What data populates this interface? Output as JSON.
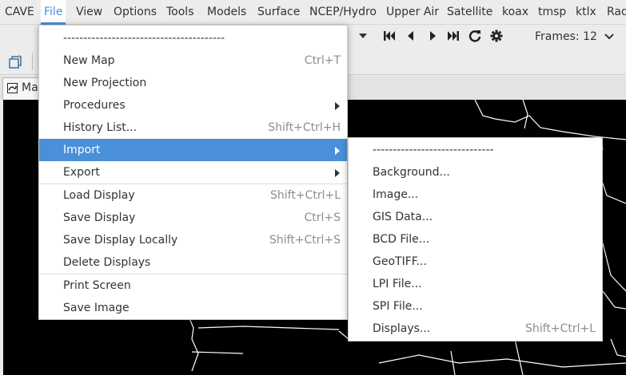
{
  "menubar": {
    "items": [
      "CAVE",
      "File",
      "View",
      "Options",
      "Tools",
      "Models",
      "Surface",
      "NCEP/Hydro",
      "Upper Air",
      "Satellite",
      "koax",
      "tmsp",
      "ktlx",
      "Rad"
    ]
  },
  "toolbar": {
    "frames_label": "Frames: 12",
    "icons": [
      "dropdown-arrow-icon",
      "first-frame-icon",
      "step-back-icon",
      "step-forward-icon",
      "last-frame-icon",
      "loop-icon",
      "settings-icon",
      "frames-dropdown-icon"
    ]
  },
  "tab": {
    "label": "Map"
  },
  "file_menu": {
    "separator_label": "----------------------------------------",
    "items": [
      {
        "label": "New Map",
        "accel": "Ctrl+T"
      },
      {
        "label": "New Projection",
        "accel": ""
      },
      {
        "label": "Procedures",
        "accel": "",
        "submenu": true
      },
      {
        "label": "History List...",
        "accel": "Shift+Ctrl+H"
      },
      {
        "label": "Import",
        "accel": "",
        "submenu": true,
        "highlighted": true
      },
      {
        "label": "Export",
        "accel": "",
        "submenu": true
      },
      {
        "label": "Load Display",
        "accel": "Shift+Ctrl+L"
      },
      {
        "label": "Save Display",
        "accel": "Ctrl+S"
      },
      {
        "label": "Save Display Locally",
        "accel": "Shift+Ctrl+S"
      },
      {
        "label": "Delete Displays",
        "accel": ""
      },
      {
        "label": "Print Screen",
        "accel": ""
      },
      {
        "label": "Save Image",
        "accel": ""
      }
    ]
  },
  "import_menu": {
    "separator_label": "------------------------------",
    "items": [
      {
        "label": "Background...",
        "accel": ""
      },
      {
        "label": "Image...",
        "accel": ""
      },
      {
        "label": "GIS Data...",
        "accel": ""
      },
      {
        "label": "BCD File...",
        "accel": ""
      },
      {
        "label": "GeoTIFF...",
        "accel": ""
      },
      {
        "label": "LPI File...",
        "accel": ""
      },
      {
        "label": "SPI File...",
        "accel": ""
      },
      {
        "label": "Displays...",
        "accel": "Shift+Ctrl+L"
      }
    ]
  },
  "colors": {
    "highlight": "#4a90d9",
    "map_background": "#000000",
    "map_lines": "#ffffff"
  }
}
